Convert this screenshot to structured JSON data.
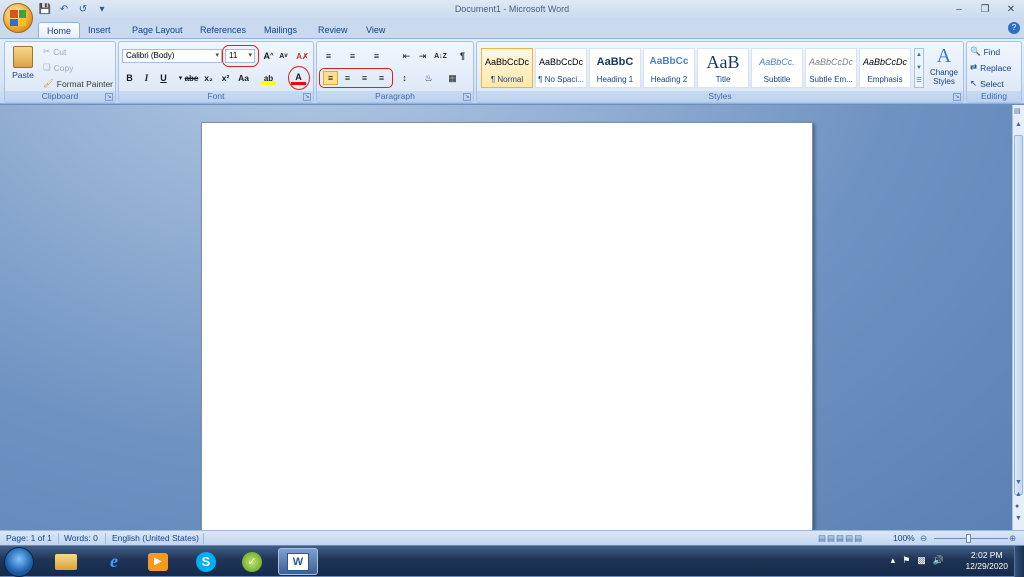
{
  "window": {
    "title": "Document1 - Microsoft Word",
    "controls": [
      "minimize",
      "restore",
      "close"
    ]
  },
  "quick_access": [
    "save-icon",
    "undo-icon",
    "redo-icon",
    "customize-icon"
  ],
  "tabs": [
    {
      "label": "Home"
    },
    {
      "label": "Insert"
    },
    {
      "label": "Page Layout"
    },
    {
      "label": "References"
    },
    {
      "label": "Mailings"
    },
    {
      "label": "Review"
    },
    {
      "label": "View"
    }
  ],
  "clipboard": {
    "paste": "Paste",
    "cut": "Cut",
    "copy": "Copy",
    "format_painter": "Format Painter",
    "label": "Clipboard"
  },
  "font": {
    "family": "Calibri (Body)",
    "size": "11",
    "label": "Font",
    "bold": "B",
    "italic": "I",
    "underline": "U",
    "strike": "abe",
    "sub": "x₂",
    "sup": "x²",
    "case": "Aa",
    "grow": "A",
    "shrink": "A",
    "color": "A",
    "highlight": "ab"
  },
  "paragraph": {
    "label": "Paragraph",
    "pilcrow": "¶"
  },
  "styles": {
    "label": "Styles",
    "items": [
      {
        "preview": "AaBbCcDc",
        "name": "¶ Normal",
        "color": "#000000"
      },
      {
        "preview": "AaBbCcDc",
        "name": "¶ No Spaci...",
        "color": "#000000"
      },
      {
        "preview": "AaBbC",
        "name": "Heading 1",
        "color": "#17365d"
      },
      {
        "preview": "AaBbCc",
        "name": "Heading 2",
        "color": "#4f81bd"
      },
      {
        "preview": "AaB",
        "name": "Title",
        "color": "#17365d"
      },
      {
        "preview": "AaBbCc.",
        "name": "Subtitle",
        "color": "#4f81bd"
      },
      {
        "preview": "AaBbCcDc",
        "name": "Subtle Em...",
        "color": "#808080"
      },
      {
        "preview": "AaBbCcDc",
        "name": "Emphasis",
        "color": "#000000"
      }
    ],
    "change": "Change Styles"
  },
  "editing": {
    "label": "Editing",
    "find": "Find",
    "replace": "Replace",
    "select": "Select"
  },
  "status": {
    "page": "Page: 1 of 1",
    "words": "Words: 0",
    "language": "English (United States)",
    "zoom": "100%"
  },
  "taskbar": {
    "time": "2:02 PM",
    "date": "12/29/2020"
  },
  "colors": {
    "accent": "#15428b",
    "annotation": "#e0211b",
    "font_color": "#ff0000"
  }
}
